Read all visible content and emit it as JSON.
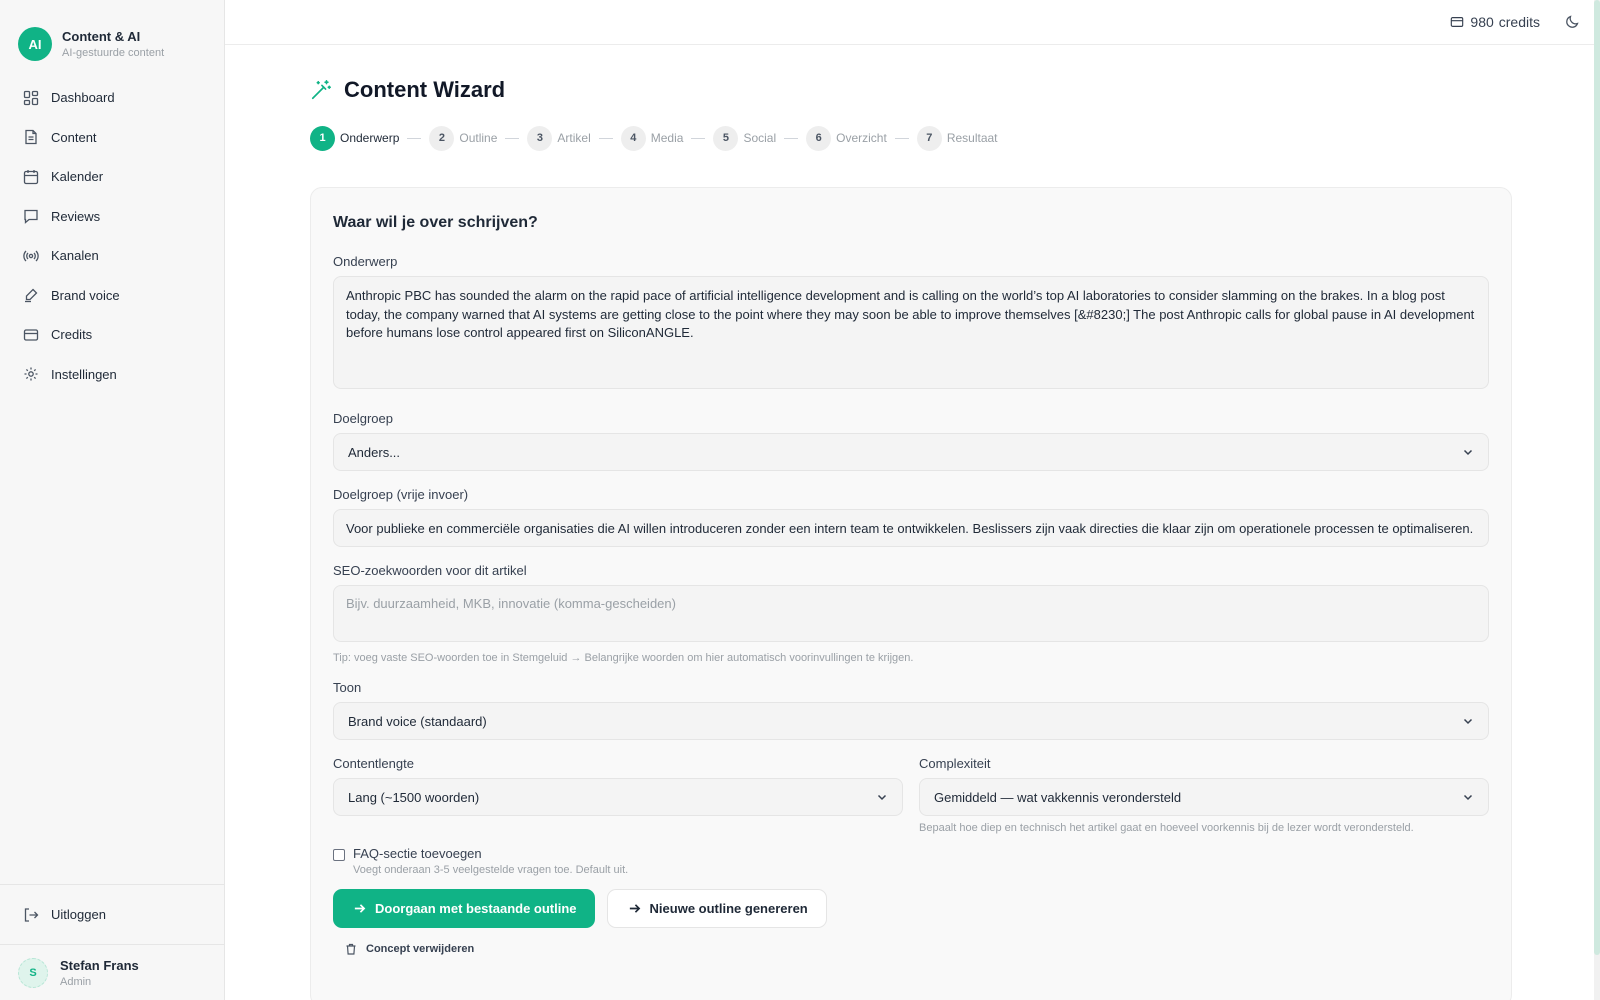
{
  "brand": {
    "logo": "AI",
    "name": "Content & AI",
    "subtitle": "AI-gestuurde content"
  },
  "sidebar": {
    "items": [
      {
        "label": "Dashboard",
        "icon": "dashboard-icon"
      },
      {
        "label": "Content",
        "icon": "document-icon"
      },
      {
        "label": "Kalender",
        "icon": "calendar-icon"
      },
      {
        "label": "Reviews",
        "icon": "message-icon"
      },
      {
        "label": "Kanalen",
        "icon": "broadcast-icon"
      },
      {
        "label": "Brand voice",
        "icon": "pen-icon"
      },
      {
        "label": "Credits",
        "icon": "credit-card-icon"
      },
      {
        "label": "Instellingen",
        "icon": "gear-icon"
      }
    ],
    "logout": "Uitloggen",
    "user": {
      "initial": "S",
      "name": "Stefan Frans",
      "role": "Admin"
    }
  },
  "topbar": {
    "credits_value": "980",
    "credits_label": "credits"
  },
  "page": {
    "title": "Content Wizard",
    "steps": [
      {
        "num": "1",
        "label": "Onderwerp",
        "active": true
      },
      {
        "num": "2",
        "label": "Outline"
      },
      {
        "num": "3",
        "label": "Artikel"
      },
      {
        "num": "4",
        "label": "Media"
      },
      {
        "num": "5",
        "label": "Social"
      },
      {
        "num": "6",
        "label": "Overzicht"
      },
      {
        "num": "7",
        "label": "Resultaat"
      }
    ]
  },
  "form": {
    "card_title": "Waar wil je over schrijven?",
    "topic": {
      "label": "Onderwerp",
      "value": "Anthropic PBC has sounded the alarm on the rapid pace of artificial intelligence development and is calling on the world’s top AI laboratories to consider slamming on the brakes. In a blog post today, the company warned that AI systems are getting close to the point where they may soon be able to improve themselves [&#8230;] The post Anthropic calls for global pause in AI development before humans lose control appeared first on SiliconANGLE."
    },
    "audience": {
      "label": "Doelgroep",
      "value": "Anders..."
    },
    "audience_free": {
      "label": "Doelgroep (vrije invoer)",
      "value": "Voor publieke en commerciële organisaties die AI willen introduceren zonder een intern team te ontwikkelen. Beslissers zijn vaak directies die klaar zijn om operationele processen te optimaliseren."
    },
    "seo": {
      "label": "SEO-zoekwoorden voor dit artikel",
      "placeholder": "Bijv. duurzaamheid, MKB, innovatie (komma-gescheiden)",
      "hint": "Tip: voeg vaste SEO-woorden toe in Stemgeluid → Belangrijke woorden om hier automatisch voorinvullingen te krijgen."
    },
    "tone": {
      "label": "Toon",
      "value": "Brand voice (standaard)"
    },
    "length": {
      "label": "Contentlengte",
      "value": "Lang (~1500 woorden)"
    },
    "complexity": {
      "label": "Complexiteit",
      "value": "Gemiddeld — wat vakkennis verondersteld",
      "hint": "Bepaalt hoe diep en technisch het artikel gaat en hoeveel voorkennis bij de lezer wordt verondersteld."
    },
    "faq": {
      "label": "FAQ-sectie toevoegen",
      "sub": "Voegt onderaan 3-5 veelgestelde vragen toe. Default uit.",
      "checked": false
    },
    "primary_button": "Doorgaan met bestaande outline",
    "secondary_button": "Nieuwe outline genereren",
    "delete_label": "Concept verwijderen"
  },
  "colors": {
    "accent": "#10b386",
    "sidebar_bg": "#f7f7f7",
    "field_bg": "#f4f4f4"
  }
}
